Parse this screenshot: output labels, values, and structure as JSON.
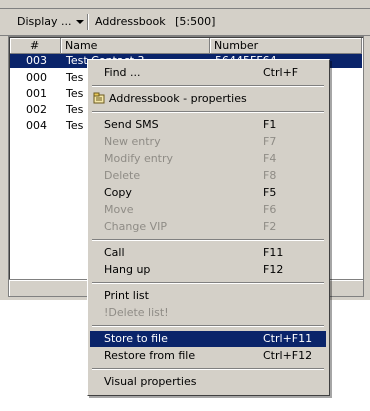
{
  "toolbar": {
    "display_label": "Display ...",
    "addressbook_label": "Addressbook",
    "count_label": "[5:500]"
  },
  "list": {
    "columns": [
      "#",
      "Name",
      "Number"
    ],
    "rows": [
      {
        "index": "003",
        "name": "Test Contact 3",
        "number": "56445FF64"
      },
      {
        "index": "000",
        "name": "Tes",
        "number": ""
      },
      {
        "index": "001",
        "name": "Tes",
        "number": ""
      },
      {
        "index": "002",
        "name": "Tes",
        "number": ""
      },
      {
        "index": "004",
        "name": "Tes",
        "number": ""
      }
    ]
  },
  "menu": {
    "items": [
      {
        "label": "Find ...",
        "shortcut": "Ctrl+F"
      },
      {
        "label": "Addressbook - properties",
        "shortcut": "",
        "icon": "properties-icon"
      },
      {
        "label": "Send SMS",
        "shortcut": "F1"
      },
      {
        "label": "New entry",
        "shortcut": "F7"
      },
      {
        "label": "Modify entry",
        "shortcut": "F4"
      },
      {
        "label": "Delete",
        "shortcut": "F8"
      },
      {
        "label": "Copy",
        "shortcut": "F5"
      },
      {
        "label": "Move",
        "shortcut": "F6"
      },
      {
        "label": "Change VIP",
        "shortcut": "F2"
      },
      {
        "label": "Call",
        "shortcut": "F11"
      },
      {
        "label": "Hang up",
        "shortcut": "F12"
      },
      {
        "label": "Print list",
        "shortcut": ""
      },
      {
        "label": "!Delete list!",
        "shortcut": ""
      },
      {
        "label": "Store to file",
        "shortcut": "Ctrl+F11"
      },
      {
        "label": "Restore from file",
        "shortcut": "Ctrl+F12"
      },
      {
        "label": "Visual properties",
        "shortcut": ""
      }
    ]
  },
  "colors": {
    "selection": "#0a246a",
    "face": "#d4d0c8",
    "disabled_text": "#8f8c86"
  }
}
